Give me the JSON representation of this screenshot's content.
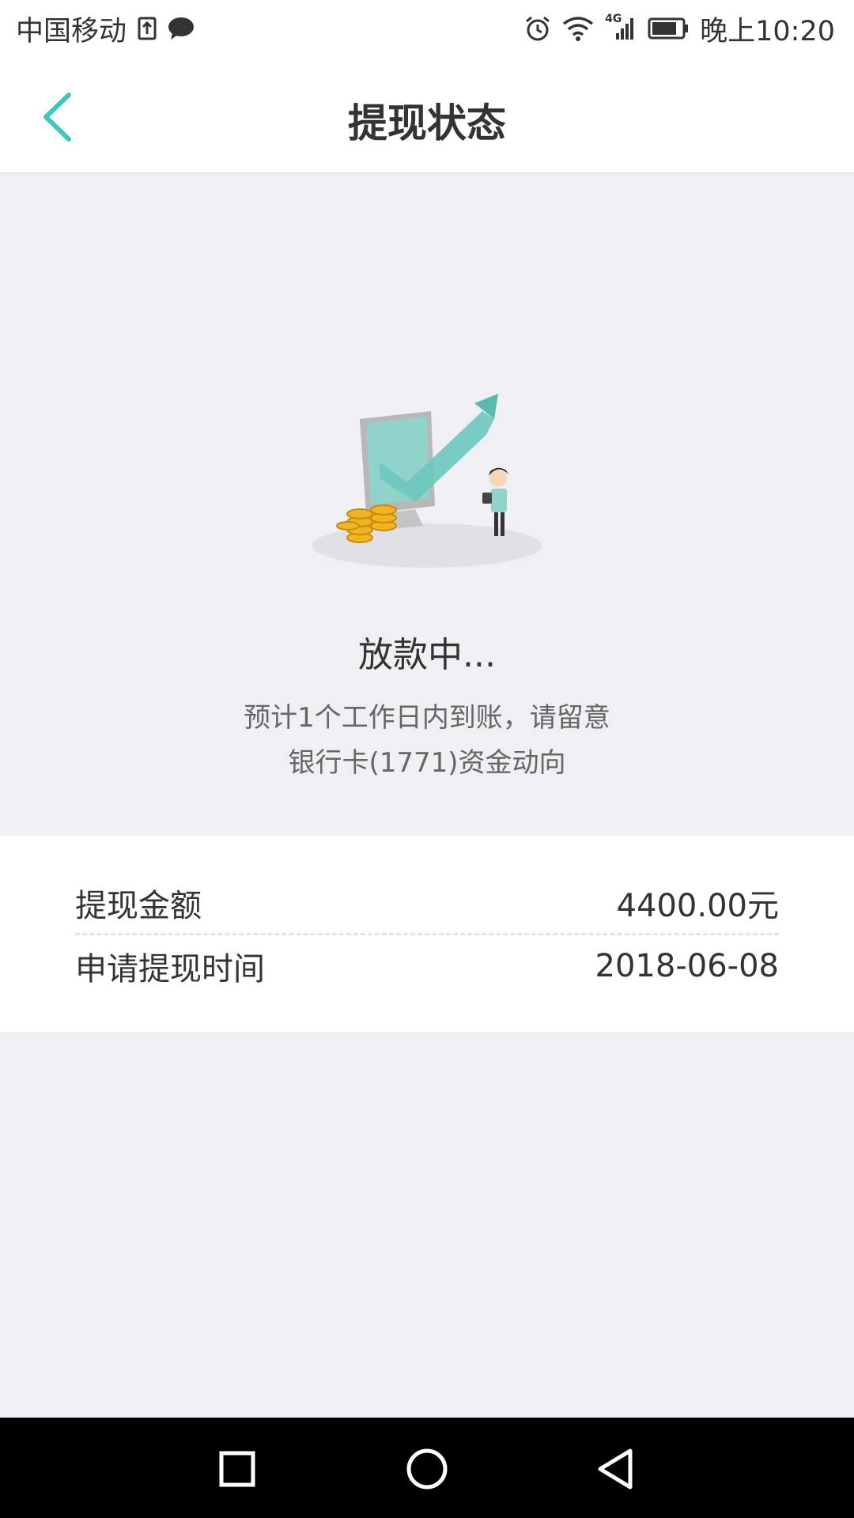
{
  "status_bar": {
    "carrier": "中国移动",
    "network": "4G",
    "time": "晚上10:20"
  },
  "header": {
    "title": "提现状态"
  },
  "status": {
    "heading": "放款中...",
    "desc_line1": "预计1个工作日内到账，请留意",
    "desc_line2": "银行卡(1771)资金动向"
  },
  "details": {
    "amount_label": "提现金额",
    "amount_value": "4400.00元",
    "date_label": "申请提现时间",
    "date_value": "2018-06-08"
  },
  "colors": {
    "accent": "#3cc8bf",
    "background": "#efeff4"
  },
  "icons": {
    "back": "chevron-left-icon",
    "nav_recent": "square-icon",
    "nav_home": "circle-icon",
    "nav_back": "triangle-back-icon"
  }
}
